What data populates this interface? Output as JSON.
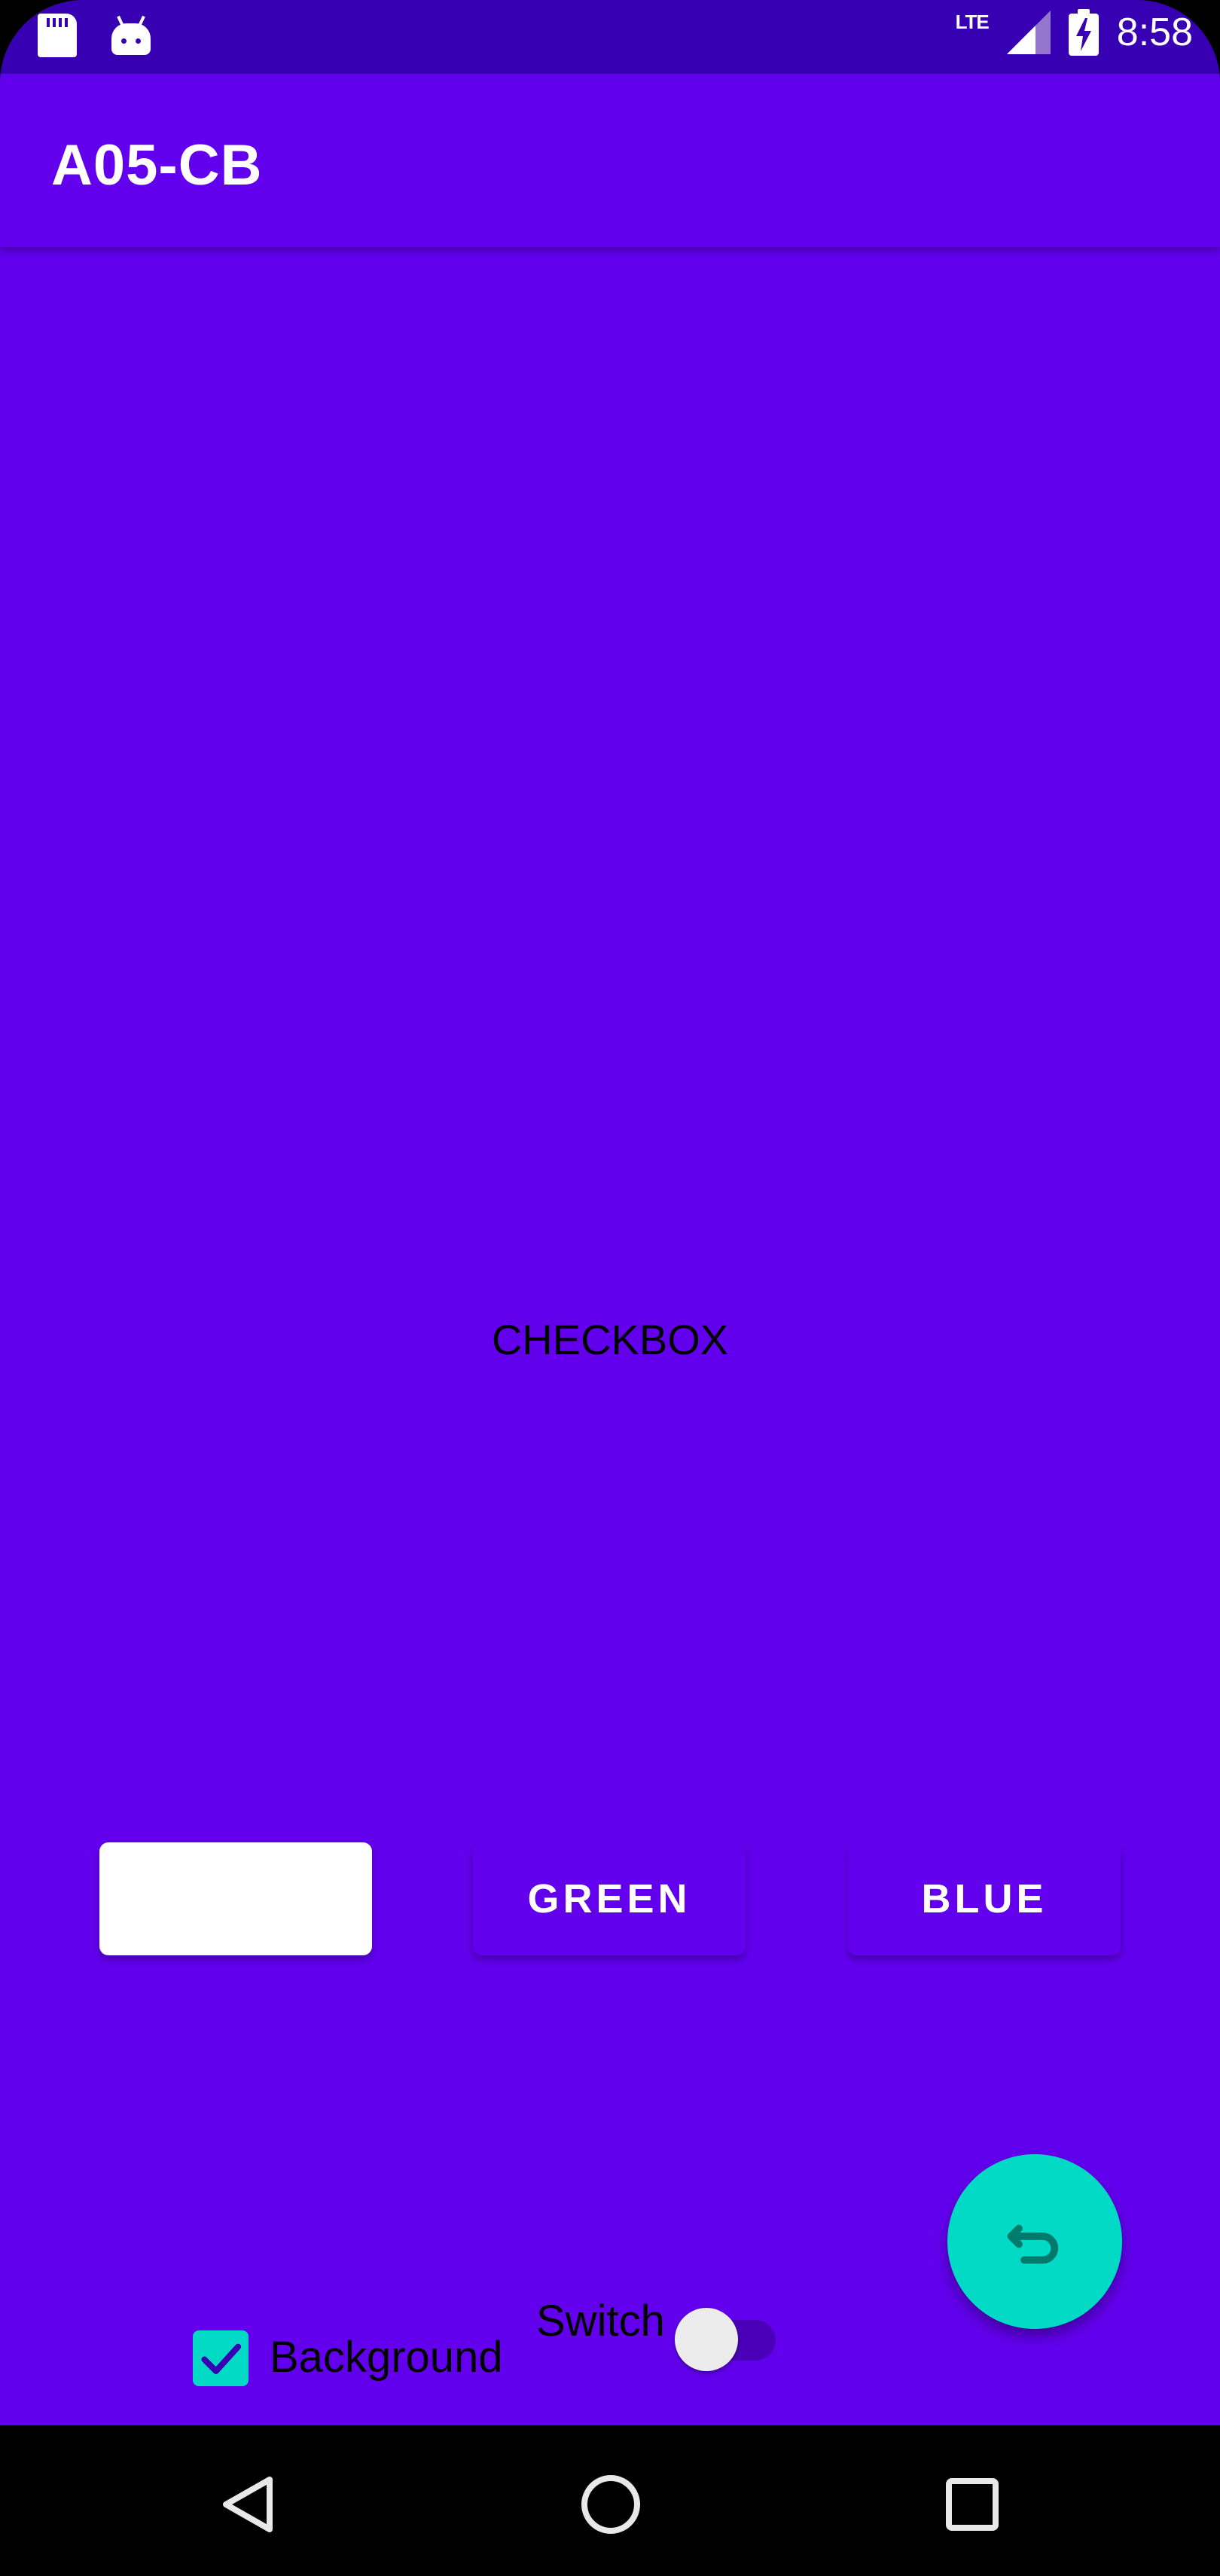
{
  "status_bar": {
    "left_icons": [
      "sd-card-icon",
      "android-debug-icon"
    ],
    "network_label": "LTE",
    "time": "8:58"
  },
  "app_bar": {
    "title": "A05-CB"
  },
  "main": {
    "center_label": "CHECKBOX",
    "color_buttons": [
      {
        "label": "",
        "background": "#FFFFFF"
      },
      {
        "label": "GREEN",
        "background": "#6200EE"
      },
      {
        "label": "BLUE",
        "background": "#6200EE"
      }
    ],
    "fab": {
      "icon": "undo-icon",
      "background": "#03DAC5"
    },
    "switch": {
      "label": "Switch",
      "checked": false
    },
    "checkbox": {
      "label": "Background",
      "checked": true
    }
  },
  "nav_bar": {
    "buttons": [
      "back-icon",
      "home-icon",
      "recents-icon"
    ]
  },
  "colors": {
    "primary": "#6200EE",
    "primary_dark": "#3700B3",
    "accent": "#03DAC5"
  }
}
